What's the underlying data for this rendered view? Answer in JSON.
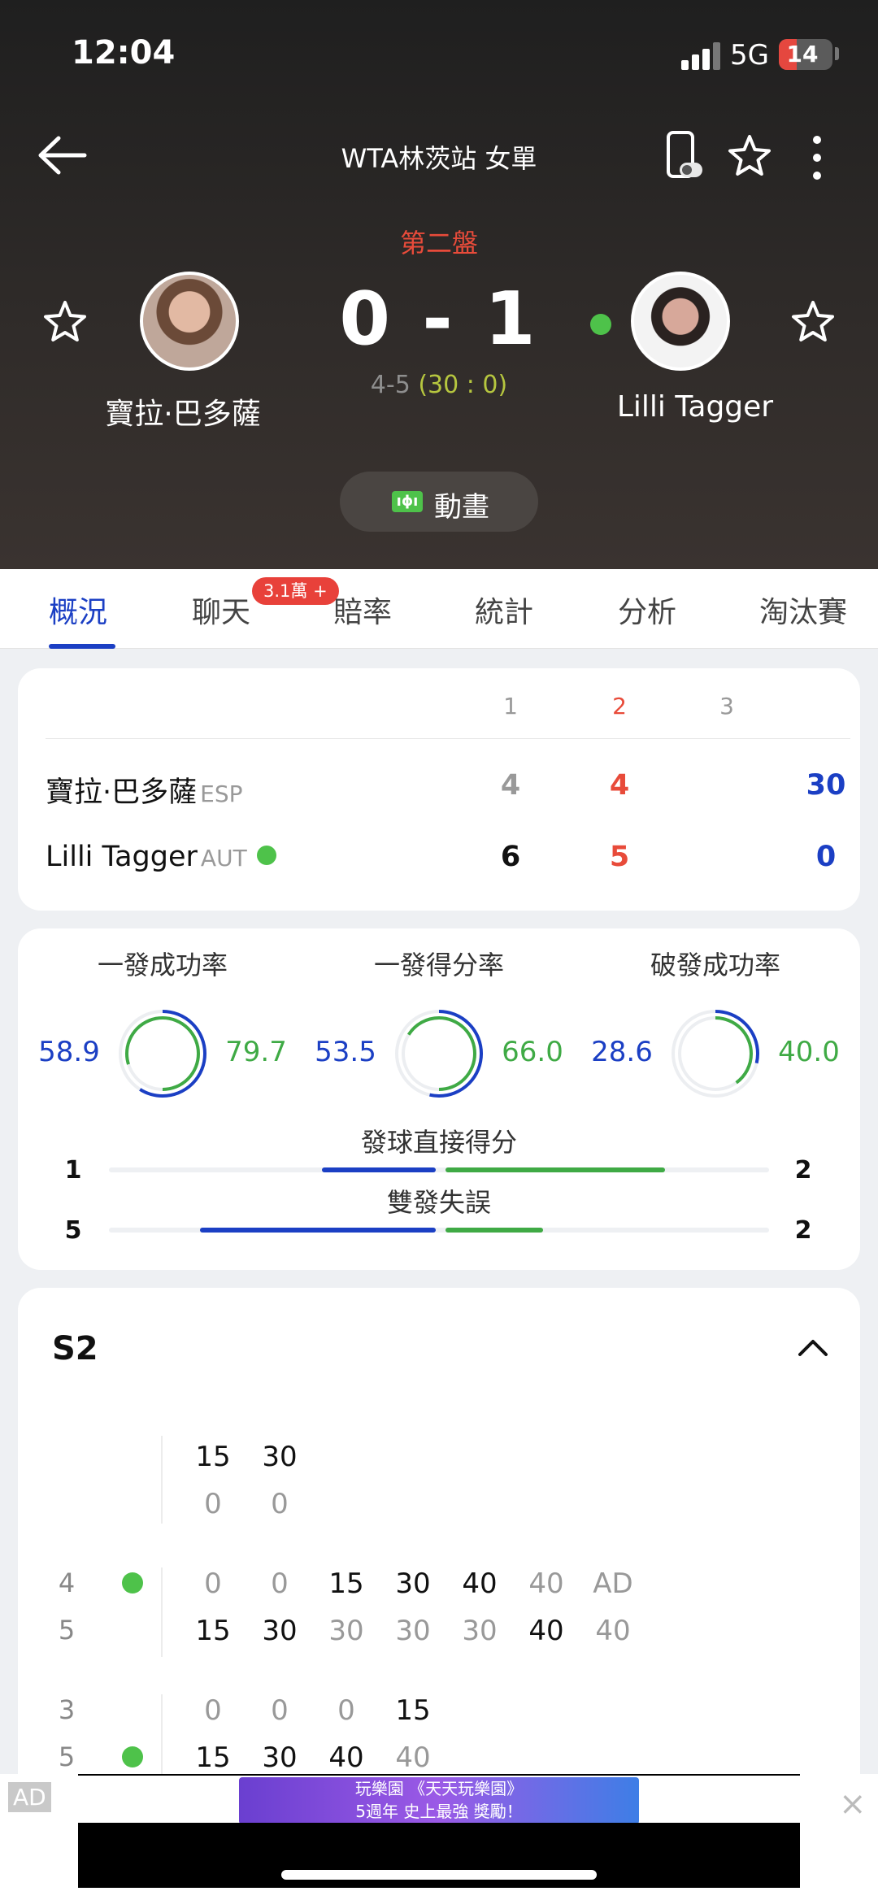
{
  "status": {
    "time": "12:04",
    "network": "5G",
    "battery": "14"
  },
  "nav": {
    "title": "WTA林茨站 女單"
  },
  "match": {
    "set_label": "第二盤",
    "left_player": "寶拉·巴多薩",
    "right_player": "Lilli Tagger",
    "set_score": "0 - 1",
    "games": "4-5",
    "points": "(30 : 0)"
  },
  "animation_label": "動畫",
  "tabs": [
    {
      "label": "概況",
      "active": true
    },
    {
      "label": "聊天",
      "badge": "3.1萬 +"
    },
    {
      "label": "賠率"
    },
    {
      "label": "統計"
    },
    {
      "label": "分析"
    },
    {
      "label": "淘汰賽"
    }
  ],
  "scoreboard": {
    "sets": [
      "1",
      "2",
      "3"
    ],
    "players": [
      {
        "name": "寶拉·巴多薩",
        "country": "ESP",
        "serving": false,
        "scores": [
          "4",
          "4",
          "30"
        ]
      },
      {
        "name": "Lilli Tagger",
        "country": "AUT",
        "serving": true,
        "scores": [
          "6",
          "5",
          "0"
        ]
      }
    ]
  },
  "stats": {
    "rings": [
      {
        "title": "一發成功率",
        "left": "58.9",
        "right": "79.7"
      },
      {
        "title": "一發得分率",
        "left": "53.5",
        "right": "66.0"
      },
      {
        "title": "破發成功率",
        "left": "28.6",
        "right": "40.0"
      }
    ],
    "bars": [
      {
        "title": "發球直接得分",
        "left": "1",
        "right": "2"
      },
      {
        "title": "雙發失誤",
        "left": "5",
        "right": "2"
      }
    ]
  },
  "pbp": {
    "title": "S2",
    "rows": [
      {
        "game": "",
        "top": [
          "15",
          "30"
        ],
        "bottom": [
          "0",
          "0"
        ]
      },
      {
        "game_top": "4",
        "game_bottom": "5",
        "top": [
          "0",
          "0",
          "15",
          "30",
          "40",
          "40",
          "AD"
        ],
        "bottom": [
          "15",
          "30",
          "30",
          "30",
          "30",
          "40",
          "40"
        ]
      },
      {
        "game_top": "3",
        "game_bottom": "5",
        "top": [
          "0",
          "0",
          "0",
          "15"
        ],
        "bottom": [
          "15",
          "30",
          "40",
          "40"
        ]
      }
    ]
  },
  "ad": {
    "tag": "AD",
    "banner_line1": "玩樂園 《天天玩樂園》",
    "banner_line2": "5週年 史上最強 獎勵！",
    "close": "×"
  },
  "colors": {
    "accent_blue": "#1b3fc4",
    "accent_green": "#3faa45",
    "accent_red": "#e84b3a"
  }
}
